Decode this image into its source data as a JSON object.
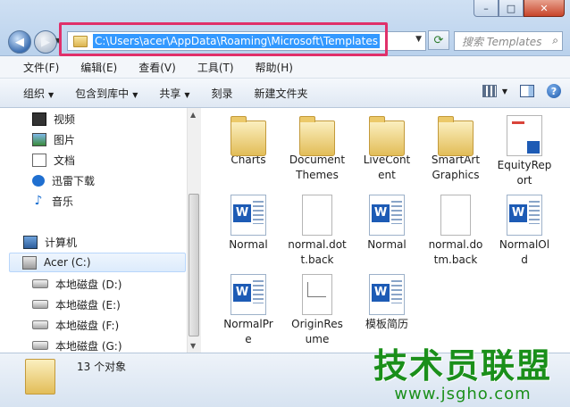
{
  "window": {
    "minimize": "–",
    "maximize": "□",
    "close": "✕"
  },
  "address_bar": {
    "path": "C:\\Users\\acer\\AppData\\Roaming\\Microsoft\\Templates"
  },
  "search": {
    "placeholder": "搜索 Templates"
  },
  "menu": [
    "文件(F)",
    "编辑(E)",
    "查看(V)",
    "工具(T)",
    "帮助(H)"
  ],
  "commands": [
    {
      "label": "组织",
      "dropdown": true
    },
    {
      "label": "包含到库中",
      "dropdown": true
    },
    {
      "label": "共享",
      "dropdown": true
    },
    {
      "label": "刻录",
      "dropdown": false
    },
    {
      "label": "新建文件夹",
      "dropdown": false
    }
  ],
  "nav": {
    "libraries": [
      {
        "label": "视频",
        "icon": "video-icon"
      },
      {
        "label": "图片",
        "icon": "pictures-icon"
      },
      {
        "label": "文档",
        "icon": "documents-icon"
      },
      {
        "label": "迅雷下载",
        "icon": "xunlei-icon"
      },
      {
        "label": "音乐",
        "icon": "music-icon"
      }
    ],
    "computer": "计算机",
    "drives": [
      "Acer (C:)",
      "本地磁盘 (D:)",
      "本地磁盘 (E:)",
      "本地磁盘 (F:)",
      "本地磁盘 (G:)"
    ]
  },
  "files": [
    {
      "name": "Charts",
      "type": "folder"
    },
    {
      "name": "Document Themes",
      "type": "folder"
    },
    {
      "name": "LiveContent",
      "type": "folder"
    },
    {
      "name": "SmartArt Graphics",
      "type": "folder"
    },
    {
      "name": "EquityReport",
      "type": "report"
    },
    {
      "name": "Normal",
      "type": "word"
    },
    {
      "name": "normal.dot.back",
      "type": "blank"
    },
    {
      "name": "Normal",
      "type": "word"
    },
    {
      "name": "normal.dotm.back",
      "type": "blank"
    },
    {
      "name": "NormalOld",
      "type": "word"
    },
    {
      "name": "NormalPre",
      "type": "word"
    },
    {
      "name": "OriginResume",
      "type": "origin"
    },
    {
      "name": "模板简历",
      "type": "word"
    }
  ],
  "file_labels": [
    [
      "Charts"
    ],
    [
      "Document",
      "Themes"
    ],
    [
      "LiveCont",
      "ent"
    ],
    [
      "SmartArt",
      "Graphics"
    ],
    [
      "EquityRep",
      "ort"
    ],
    [
      "Normal"
    ],
    [
      "normal.dot",
      "t.back"
    ],
    [
      "Normal"
    ],
    [
      "normal.do",
      "tm.back"
    ],
    [
      "NormalOl",
      "d"
    ],
    [
      "NormalPr",
      "e"
    ],
    [
      "OriginRes",
      "ume"
    ],
    [
      "模板简历"
    ]
  ],
  "status": {
    "count": "13 个对象"
  },
  "watermark": {
    "title": "技术员联盟",
    "url": "www.jsgho.com"
  }
}
